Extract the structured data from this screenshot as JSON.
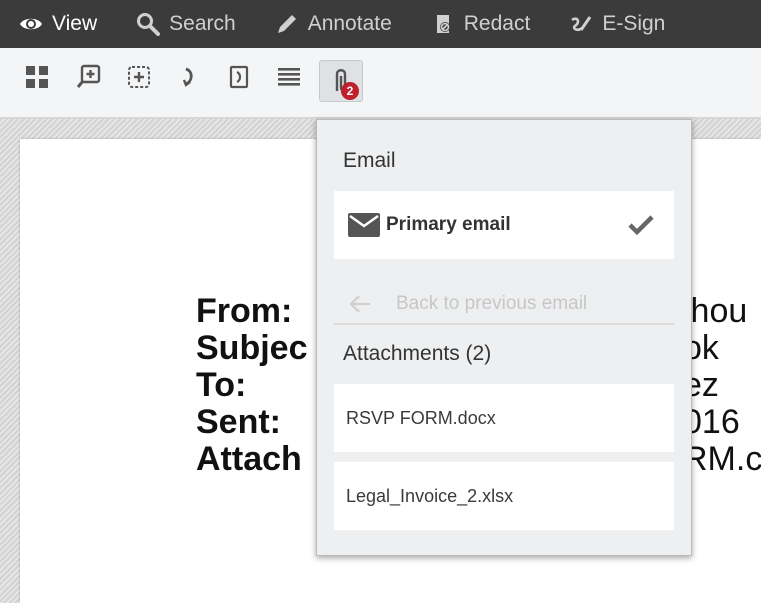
{
  "nav": {
    "items": [
      {
        "label": "View",
        "icon": "eye-icon",
        "active": true
      },
      {
        "label": "Search",
        "icon": "search-icon"
      },
      {
        "label": "Annotate",
        "icon": "pencil-icon"
      },
      {
        "label": "Redact",
        "icon": "redact-icon"
      },
      {
        "label": "E-Sign",
        "icon": "signature-icon"
      }
    ]
  },
  "toolbar": {
    "tools": [
      "thumbnails-icon",
      "zoom-in-icon",
      "fit-icon",
      "rotate-icon",
      "page-icon",
      "text-lines-icon",
      "attachments-icon"
    ],
    "attachments_badge": "2"
  },
  "document": {
    "labels": [
      "From:",
      "Subjec",
      "To:",
      "Sent:",
      "Attach"
    ],
    "values": [
      "lhou",
      "ok",
      "ez",
      "016",
      "RM.c"
    ]
  },
  "panel": {
    "email_heading": "Email",
    "primary_email_label": "Primary email",
    "back_label": "Back to previous email",
    "attachments_heading": "Attachments (2)",
    "attachments": [
      "RSVP FORM.docx",
      "Legal_Invoice_2.xlsx"
    ]
  },
  "colors": {
    "topbar": "#3b3b3c",
    "badge": "#c0202b",
    "panel_bg": "#eeeff0"
  }
}
